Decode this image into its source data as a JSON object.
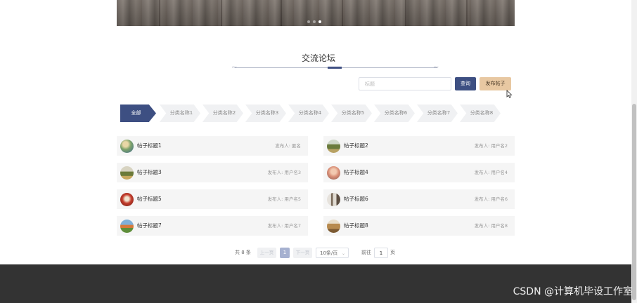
{
  "section": {
    "title": "交流论坛"
  },
  "search": {
    "placeholder": "标题",
    "query_label": "查询",
    "post_label": "发布帖子"
  },
  "categories": [
    "全部",
    "分类名称1",
    "分类名称2",
    "分类名称3",
    "分类名称4",
    "分类名称5",
    "分类名称6",
    "分类名称7",
    "分类名称8"
  ],
  "posts": [
    {
      "title": "帖子标题1",
      "author_label": "发布人:",
      "author": "匿名"
    },
    {
      "title": "帖子标题2",
      "author_label": "发布人:",
      "author": "用户名2"
    },
    {
      "title": "帖子标题3",
      "author_label": "发布人:",
      "author": "用户名3"
    },
    {
      "title": "帖子标题4",
      "author_label": "发布人:",
      "author": "用户名4"
    },
    {
      "title": "帖子标题5",
      "author_label": "发布人:",
      "author": "用户名5"
    },
    {
      "title": "帖子标题6",
      "author_label": "发布人:",
      "author": "用户名6"
    },
    {
      "title": "帖子标题7",
      "author_label": "发布人:",
      "author": "用户名7"
    },
    {
      "title": "帖子标题8",
      "author_label": "发布人:",
      "author": "用户名8"
    }
  ],
  "pagination": {
    "total": "共 8 条",
    "prev": "上一页",
    "current": "1",
    "next": "下一页",
    "page_size": "10条/页",
    "goto_label": "前往",
    "goto_value": "1",
    "goto_suffix": "页"
  },
  "carousel": {
    "slides": 3,
    "active": 3
  },
  "colors": {
    "primary": "#3d4f82",
    "accent": "#e8c8a2",
    "footer": "#333333"
  },
  "icons": {
    "dropdown": "chevron-down-icon",
    "cursor": "mouse-cursor-icon"
  },
  "watermark": "CSDN @计算机毕设工作室"
}
